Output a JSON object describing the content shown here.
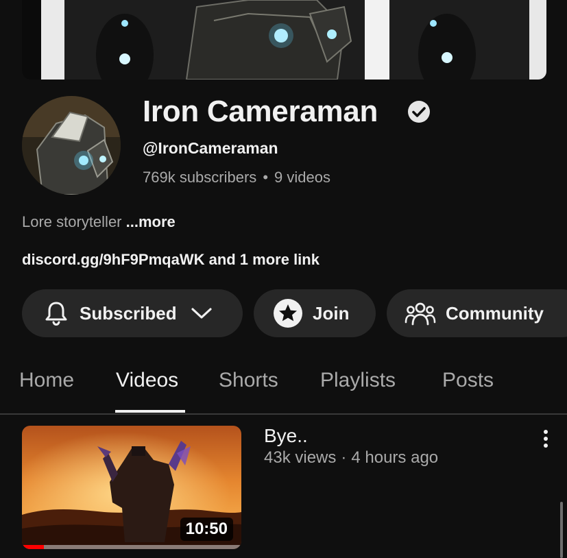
{
  "channel": {
    "name": "Iron Cameraman",
    "handle": "@IronCameraman",
    "subscribers": "769k subscribers",
    "separator": "•",
    "videos": "9 videos",
    "description": "Lore storyteller",
    "more_label": "...more",
    "links_text": "discord.gg/9hF9PmqaWK and 1 more link",
    "verified_icon": "verified-check-icon"
  },
  "actions": {
    "subscribed_label": "Subscribed",
    "join_label": "Join",
    "community_label": "Community"
  },
  "tabs": [
    {
      "label": "Home",
      "active": false
    },
    {
      "label": "Videos",
      "active": true
    },
    {
      "label": "Shorts",
      "active": false
    },
    {
      "label": "Playlists",
      "active": false
    },
    {
      "label": "Posts",
      "active": false
    }
  ],
  "videos": [
    {
      "title": "Bye..",
      "views": "43k views",
      "separator": "·",
      "age": "4 hours ago",
      "duration": "10:50",
      "watched_fraction": 0.1
    }
  ],
  "colors": {
    "background": "#0f0f0f",
    "button_bg": "#272727",
    "text_primary": "#f1f1f1",
    "text_secondary": "#aaaaaa",
    "progress_red": "#ff0000"
  }
}
